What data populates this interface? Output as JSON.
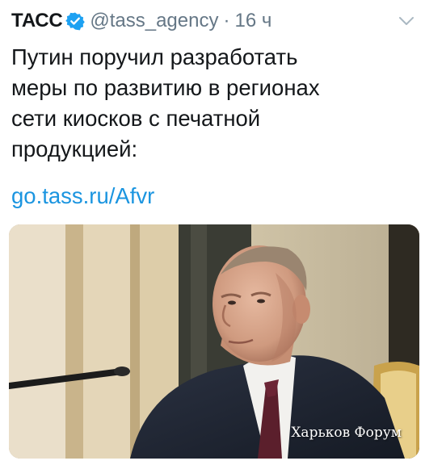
{
  "tweet": {
    "author_name": "ТАСС",
    "handle": "@tass_agency",
    "separator": "·",
    "time": "16 ч",
    "verified_icon": "verified-badge-icon",
    "menu_icon": "chevron-down-icon",
    "text_lines": [
      "Путин поручил разработать",
      "меры по развитию в регионах",
      "сети киосков с печатной",
      "продукцией:"
    ],
    "link": "go.tass.ru/Afvr"
  },
  "media": {
    "watermark": "Харьков Форум"
  },
  "colors": {
    "text": "#14171a",
    "secondary": "#657786",
    "link": "#1b95e0",
    "verified": "#1da1f2"
  }
}
